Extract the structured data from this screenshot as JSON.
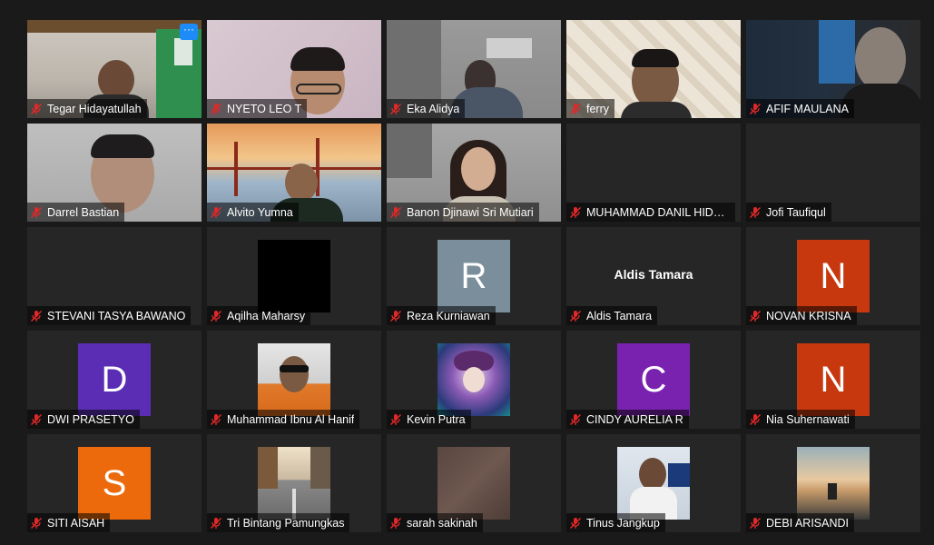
{
  "participants": [
    {
      "name": "Tegar Hidayatullah"
    },
    {
      "name": "NYETO LEO T"
    },
    {
      "name": "Eka Alidya"
    },
    {
      "name": "ferry"
    },
    {
      "name": "AFIF MAULANA"
    },
    {
      "name": "Darrel Bastian"
    },
    {
      "name": "Alvito Yumna"
    },
    {
      "name": "Banon Djinawi Sri Mutiari"
    },
    {
      "name": "MUHAMMAD DANIL HIDAY..."
    },
    {
      "name": "Jofi Taufiqul"
    },
    {
      "name": "STEVANI TASYA BAWANO"
    },
    {
      "name": "Aqilha Maharsy"
    },
    {
      "name": "Reza Kurniawan",
      "avatar_letter": "R",
      "avatar_color": "#7a8f9b"
    },
    {
      "name": "Aldis Tamara",
      "center_text": "Aldis Tamara"
    },
    {
      "name": "NOVAN KRISNA",
      "avatar_letter": "N",
      "avatar_color": "#c8380f"
    },
    {
      "name": "DWI PRASETYO",
      "avatar_letter": "D",
      "avatar_color": "#5a2db4"
    },
    {
      "name": "Muhammad Ibnu Al Hanif"
    },
    {
      "name": "Kevin Putra"
    },
    {
      "name": "CINDY AURELIA R",
      "avatar_letter": "C",
      "avatar_color": "#7a22b0"
    },
    {
      "name": "Nia Suhernawati",
      "avatar_letter": "N",
      "avatar_color": "#c8380f"
    },
    {
      "name": "SITI AISAH",
      "avatar_letter": "S",
      "avatar_color": "#ec6a0c"
    },
    {
      "name": "Tri Bintang Pamungkas"
    },
    {
      "name": "sarah sakinah"
    },
    {
      "name": "Tinus Jangkup"
    },
    {
      "name": "DEBI ARISANDI"
    }
  ],
  "more_button": {
    "icon": "ellipsis-icon",
    "glyph": "···"
  },
  "colors": {
    "background": "#1a1a1a",
    "tile": "#262626",
    "muted_mic": "#e02828",
    "accent": "#1d8cf8"
  }
}
